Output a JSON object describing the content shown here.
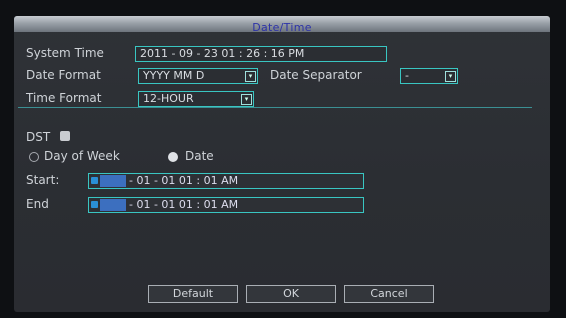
{
  "window": {
    "title": "Date/Time"
  },
  "system_time": {
    "label": "System Time",
    "value": "2011 - 09 - 23 01 : 26 : 16   PM"
  },
  "date_format": {
    "label": "Date Format",
    "value": "YYYY MM D"
  },
  "date_separator": {
    "label": "Date Separator",
    "value": "-"
  },
  "time_format": {
    "label": "Time Format",
    "value": "12-HOUR"
  },
  "dst": {
    "label": "DST",
    "enabled": true,
    "mode_options": [
      "Day of Week",
      "Date"
    ],
    "selected_mode": "Date",
    "start_label": "Start:",
    "start_value": "- 01 - 01  01 : 01        AM",
    "end_label": "End",
    "end_value": "- 01 - 01  01 : 01        AM"
  },
  "buttons": {
    "default": "Default",
    "ok": "OK",
    "cancel": "Cancel"
  },
  "colors": {
    "accent_border": "#39c6c2",
    "title_text": "#2d33a8",
    "selection": "#3c6fbf"
  },
  "icons": {
    "dropdown": "dropdown-arrow-icon",
    "checkbox": "checkbox-icon"
  }
}
